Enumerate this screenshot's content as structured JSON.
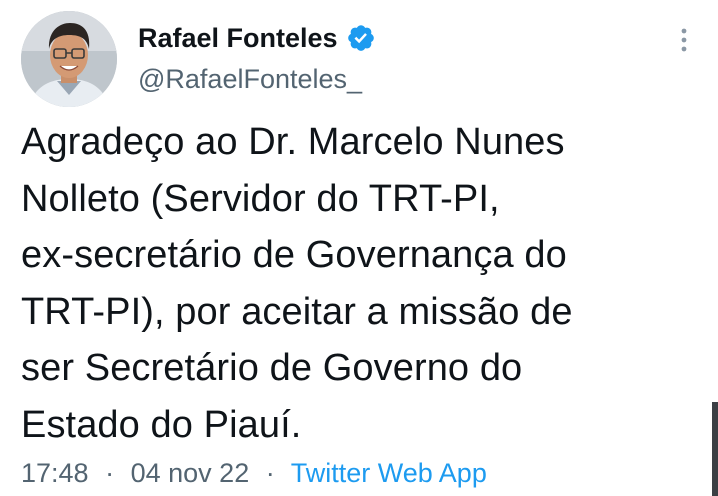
{
  "tweet": {
    "author": {
      "display_name": "Rafael Fonteles",
      "handle": "@RafaelFonteles_",
      "verified": true
    },
    "text": "Agradeço ao Dr. Marcelo Nunes\nNolleto (Servidor do TRT-PI,\nex-secretário de Governança do\nTRT-PI), por aceitar a missão de\nser Secretário de Governo do\nEstado do Piauí.",
    "time": "17:48",
    "separator": "·",
    "date": "04 nov 22",
    "source": "Twitter Web App"
  },
  "icons": {
    "verified": "verified-badge-icon",
    "more": "more-options-icon"
  },
  "colors": {
    "accent": "#1d9bf0",
    "text_primary": "#0f1419",
    "text_secondary": "#536471"
  }
}
